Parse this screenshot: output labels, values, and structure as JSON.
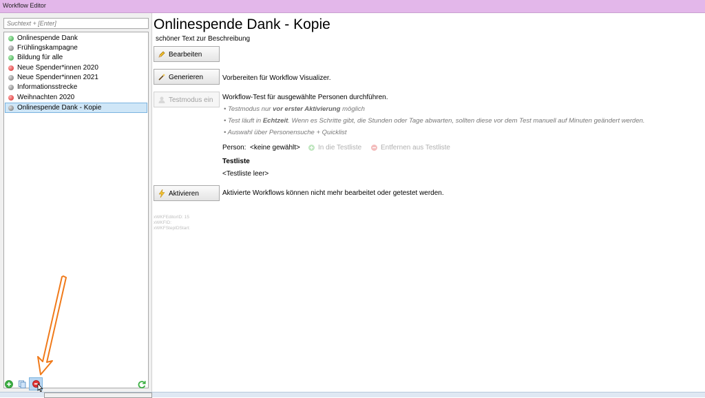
{
  "window": {
    "title": "Workflow Editor"
  },
  "search": {
    "placeholder": "Suchtext + [Enter]"
  },
  "workflows": [
    {
      "label": "Onlinespende Dank",
      "status": "green"
    },
    {
      "label": "Frühlingskampagne",
      "status": "gray"
    },
    {
      "label": "Bildung für alle",
      "status": "green"
    },
    {
      "label": "Neue Spender*innen 2020",
      "status": "red"
    },
    {
      "label": "Neue Spender*innen 2021",
      "status": "gray"
    },
    {
      "label": "Informationsstrecke",
      "status": "gray"
    },
    {
      "label": "Weihnachten 2020",
      "status": "red"
    },
    {
      "label": "Onlinespende Dank - Kopie",
      "status": "gray",
      "selected": true
    }
  ],
  "detail": {
    "title": "Onlinespende Dank - Kopie",
    "description": "schöner Text zur Beschreibung",
    "edit_label": "Bearbeiten",
    "generate_label": "Generieren",
    "generate_desc": "Vorbereiten für Workflow Visualizer.",
    "testmode_label": "Testmodus ein",
    "testmode_desc": "Workflow-Test für ausgewählte Personen durchführen.",
    "bullet1_pre": "Testmodus nur ",
    "bullet1_bold": "vor erster Aktivierung",
    "bullet1_post": " möglich",
    "bullet2_pre": "Test läuft in ",
    "bullet2_bold": "Echtzeit",
    "bullet2_post": ". Wenn es Schritte gibt, die Stunden oder Tage abwarten, sollten diese vor dem Test manuell auf Minuten geändert werden.",
    "bullet3": "Auswahl über Personensuche + Quicklist",
    "person_label": "Person:",
    "person_value": "<keine gewählt>",
    "add_testlist": "In die Testliste",
    "remove_testlist": "Entfernen aus Testliste",
    "testlist_heading": "Testliste",
    "testlist_empty": "<Testliste leer>",
    "activate_label": "Aktivieren",
    "activate_desc": "Aktivierte Workflows können nicht mehr bearbeitet oder getestet werden.",
    "id_editor": "xWKFEditorID: 15",
    "id_wkf": "xWKFID:",
    "id_step": "xWKFStepIDStart:"
  },
  "colors": {
    "titlebar": "#e3b7ea",
    "selection": "#cfe6f7",
    "status_green": "#2ea043",
    "status_red": "#d62020",
    "status_gray": "#6d6d6d",
    "annotation_arrow": "#f07a1a"
  }
}
